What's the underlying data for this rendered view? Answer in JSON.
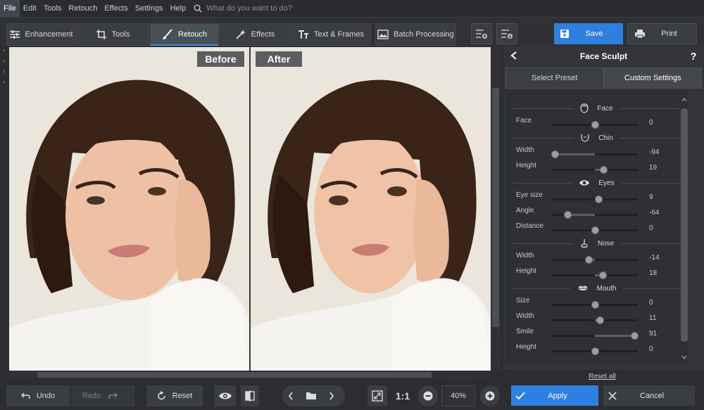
{
  "menu": {
    "items": [
      "File",
      "Edit",
      "Tools",
      "Retouch",
      "Effects",
      "Settings",
      "Help"
    ],
    "active": "File",
    "search_placeholder": "What do you want to do?"
  },
  "toolbar": {
    "tabs": [
      {
        "label": "Enhancement",
        "icon": "sliders-icon"
      },
      {
        "label": "Tools",
        "icon": "crop-icon"
      },
      {
        "label": "Retouch",
        "icon": "brush-icon",
        "active": true
      },
      {
        "label": "Effects",
        "icon": "magic-wand-icon"
      },
      {
        "label": "Text & Frames",
        "icon": "text-icon"
      },
      {
        "label": "Batch Processing",
        "icon": "images-icon"
      }
    ],
    "save_label": "Save",
    "print_label": "Print"
  },
  "canvas": {
    "before_label": "Before",
    "after_label": "After"
  },
  "panel": {
    "title": "Face Sculpt",
    "tabs": [
      "Select Preset",
      "Custom Settings"
    ],
    "active_tab": "Custom Settings",
    "sections": [
      {
        "name": "Face",
        "icon": "face-icon",
        "sliders": [
          {
            "label": "Face",
            "value": 0
          }
        ]
      },
      {
        "name": "Chin",
        "icon": "chin-icon",
        "sliders": [
          {
            "label": "Width",
            "value": -94
          },
          {
            "label": "Height",
            "value": 19
          }
        ]
      },
      {
        "name": "Eyes",
        "icon": "eye-icon",
        "sliders": [
          {
            "label": "Eye size",
            "value": 9
          },
          {
            "label": "Angle",
            "value": -64
          },
          {
            "label": "Distance",
            "value": 0
          }
        ]
      },
      {
        "name": "Nose",
        "icon": "nose-icon",
        "sliders": [
          {
            "label": "Width",
            "value": -14
          },
          {
            "label": "Height",
            "value": 18
          }
        ]
      },
      {
        "name": "Mouth",
        "icon": "lips-icon",
        "sliders": [
          {
            "label": "Size",
            "value": 0
          },
          {
            "label": "Width",
            "value": 11
          },
          {
            "label": "Smile",
            "value": 91
          },
          {
            "label": "Height",
            "value": 0
          }
        ]
      }
    ],
    "reset_all_label": "Reset all"
  },
  "bottom": {
    "undo_label": "Undo",
    "redo_label": "Redo",
    "reset_label": "Reset",
    "ratio_label": "1:1",
    "zoom_value": "40%",
    "apply_label": "Apply",
    "cancel_label": "Cancel"
  },
  "colors": {
    "accent": "#2f7fe0",
    "background": "#2b2d30",
    "panel": "#333538"
  }
}
